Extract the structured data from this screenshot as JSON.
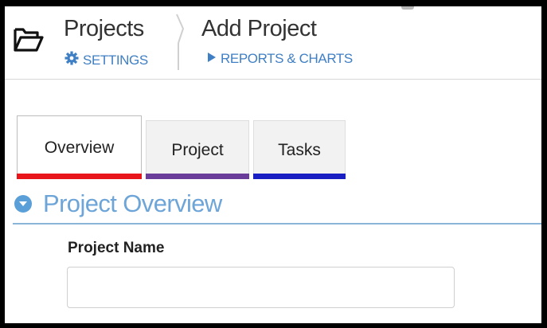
{
  "header": {
    "icon": "folder-icon",
    "breadcrumb": [
      {
        "label": "Projects",
        "sublink": {
          "icon": "gear-icon",
          "label": "SETTINGS"
        }
      },
      {
        "label": "Add Project",
        "sublink": {
          "icon": "play-icon",
          "label": "REPORTS & CHARTS"
        }
      }
    ]
  },
  "tabs": [
    {
      "label": "Overview",
      "active": true,
      "color": "#e8161b"
    },
    {
      "label": "Project",
      "active": false,
      "color": "#6a3d9a"
    },
    {
      "label": "Tasks",
      "active": false,
      "color": "#1a1fc4"
    }
  ],
  "section": {
    "icon": "chevron-down-icon",
    "title": "Project Overview"
  },
  "form": {
    "project_name": {
      "label": "Project Name",
      "value": "",
      "placeholder": ""
    }
  },
  "colors": {
    "link": "#3f7fc4",
    "section_title": "#6ea5d8",
    "section_rule": "#8ab4d8"
  }
}
